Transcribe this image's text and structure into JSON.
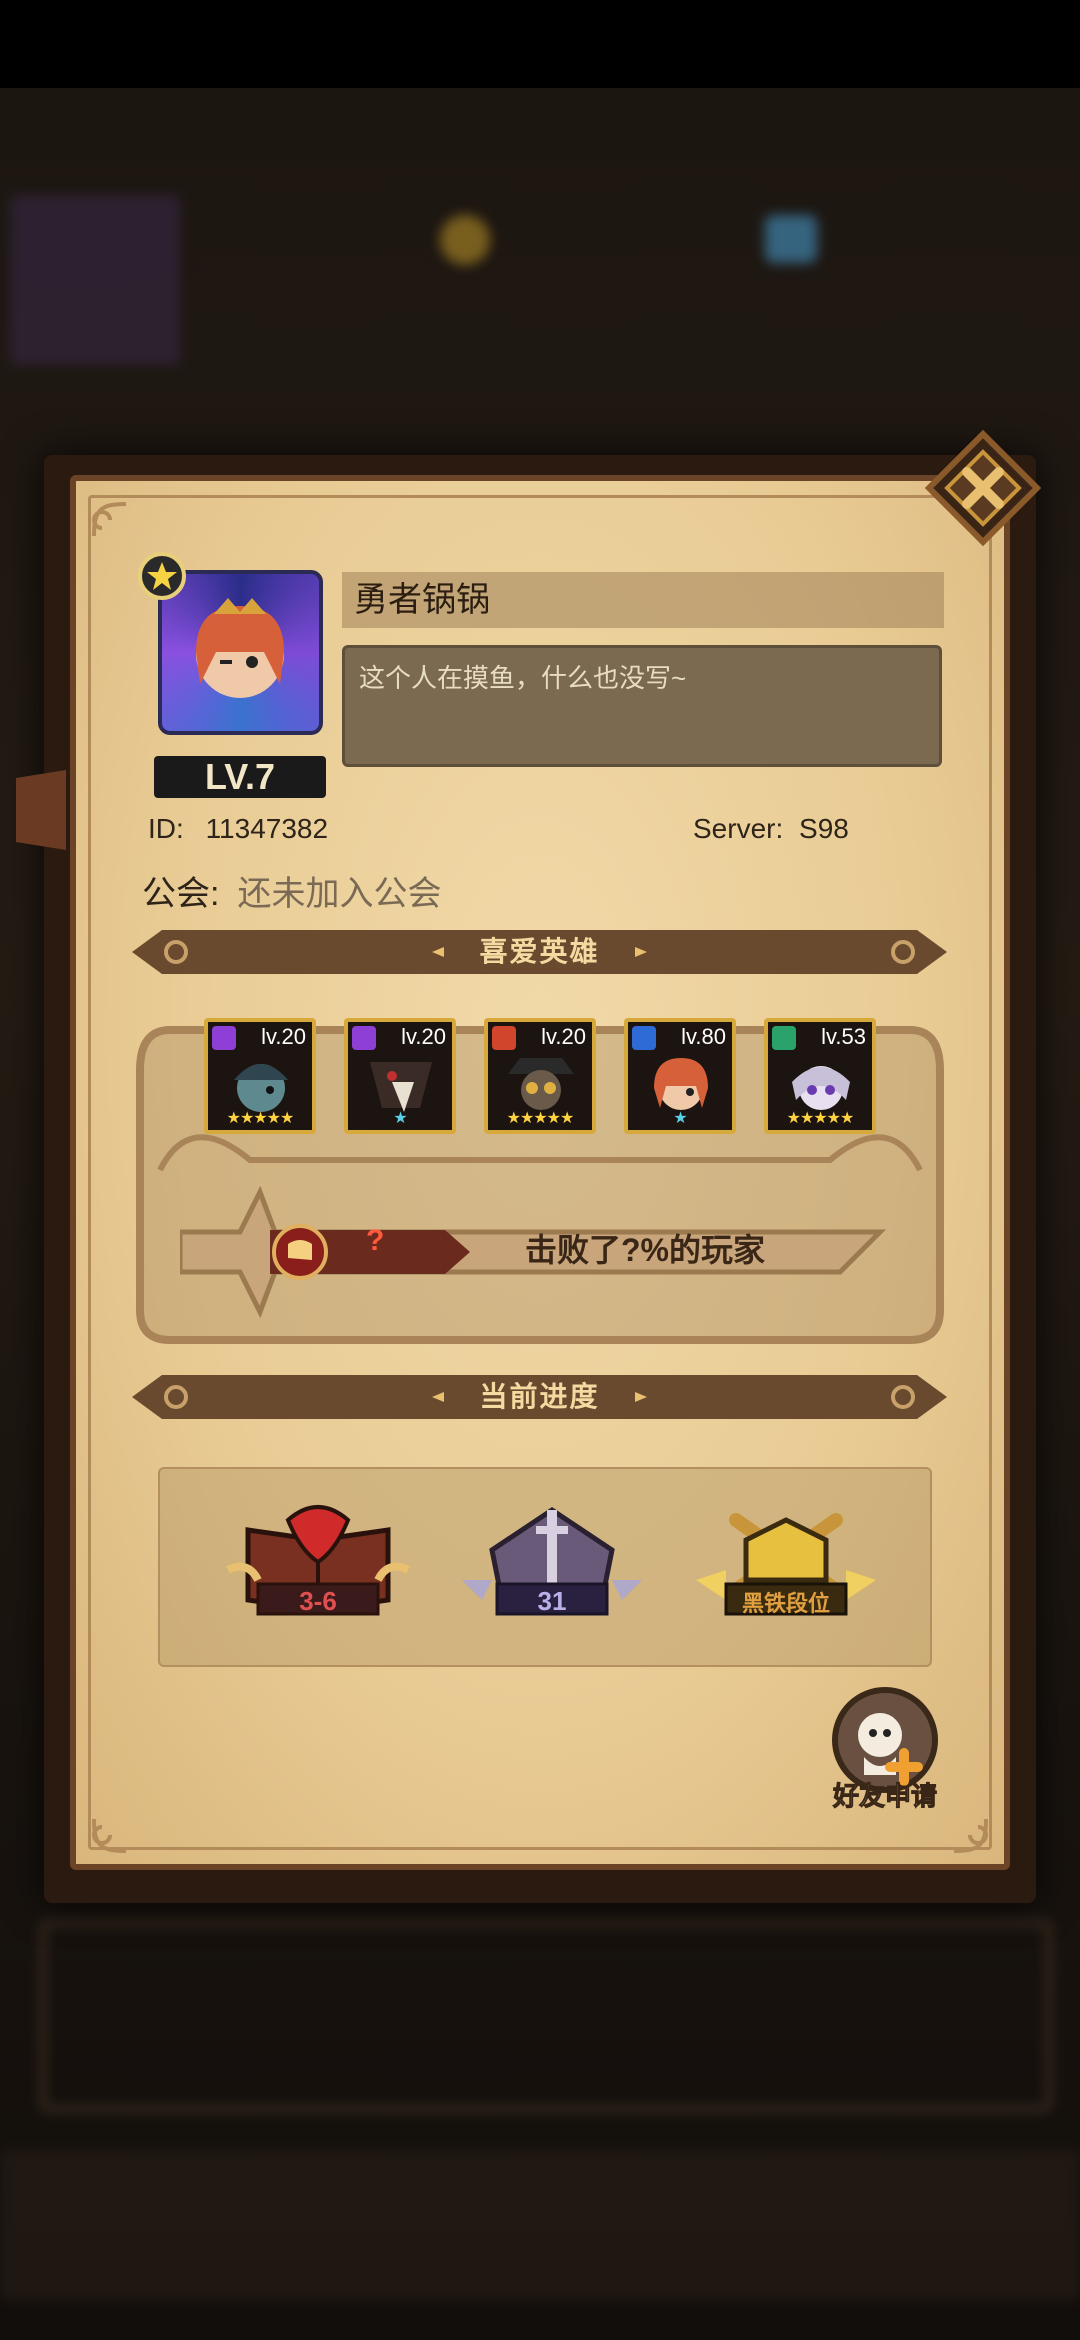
{
  "profile": {
    "name": "勇者锅锅",
    "signature": "这个人在摸鱼，什么也没写~",
    "level_label": "LV.7",
    "id_label": "ID:",
    "id_value": "11347382",
    "server_label": "Server:",
    "server_value": "S98",
    "guild_label": "公会:",
    "guild_value": "还未加入公会"
  },
  "favorite_heroes": {
    "title": "喜爱英雄",
    "heroes": [
      {
        "level": "lv.20",
        "stars": "★★★★★",
        "element_color": "#8e3fd6"
      },
      {
        "level": "lv.20",
        "stars": "★",
        "element_color": "#8e3fd6"
      },
      {
        "level": "lv.20",
        "stars": "★★★★★",
        "element_color": "#d0452b"
      },
      {
        "level": "lv.80",
        "stars": "★",
        "element_color": "#2f6bd6"
      },
      {
        "level": "lv.53",
        "stars": "★★★★★",
        "element_color": "#2aa36a"
      }
    ]
  },
  "defeat": {
    "rank_value": "?",
    "text": "击败了?%的玩家"
  },
  "progress": {
    "title": "当前进度",
    "items": [
      {
        "label": "3-6",
        "icon": "campaign-book-icon"
      },
      {
        "label": "31",
        "icon": "tower-icon"
      },
      {
        "label": "黑铁段位",
        "icon": "arena-rank-icon"
      }
    ]
  },
  "friend_request": {
    "label": "好友申请"
  },
  "colors": {
    "accent_gold": "#d6a93a",
    "banner": "#6a4a2e",
    "panel": "#e9cc95"
  }
}
